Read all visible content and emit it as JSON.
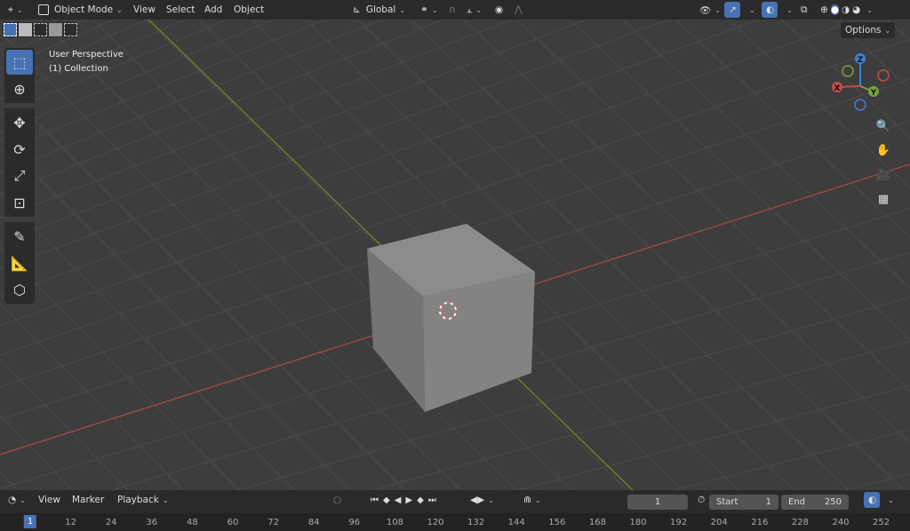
{
  "header": {
    "mode": "Object Mode",
    "menus": [
      "View",
      "Select",
      "Add",
      "Object"
    ],
    "transform_orientation": "Global",
    "options": "Options"
  },
  "overlay": {
    "view_name": "User Perspective",
    "collection": "(1) Collection"
  },
  "gizmo": {
    "x": "X",
    "y": "Y",
    "z": "Z"
  },
  "tools": [
    {
      "name": "select-box-tool",
      "glyph": "⬚",
      "active": true
    },
    {
      "name": "cursor-tool",
      "glyph": "⊕"
    },
    {
      "name": "move-tool",
      "glyph": "✥"
    },
    {
      "name": "rotate-tool",
      "glyph": "⟳"
    },
    {
      "name": "scale-tool",
      "glyph": "⤢"
    },
    {
      "name": "transform-tool",
      "glyph": "⊡"
    },
    {
      "name": "annotate-tool",
      "glyph": "✎"
    },
    {
      "name": "measure-tool",
      "glyph": "📐"
    },
    {
      "name": "add-cube-tool",
      "glyph": "⬡"
    }
  ],
  "timeline": {
    "menus": [
      "View",
      "Marker",
      "Playback"
    ],
    "current_frame": "1",
    "start_label": "Start",
    "start": "1",
    "end_label": "End",
    "end": "250",
    "ticks": [
      "1",
      "12",
      "24",
      "36",
      "48",
      "60",
      "72",
      "84",
      "96",
      "108",
      "120",
      "132",
      "144",
      "156",
      "168",
      "180",
      "192",
      "204",
      "216",
      "228",
      "240",
      "252"
    ]
  },
  "colors": {
    "accent": "#4772b3",
    "x_axis": "#c84a4a",
    "y_axis": "#7aa13a",
    "z_axis": "#3f7fd6"
  }
}
